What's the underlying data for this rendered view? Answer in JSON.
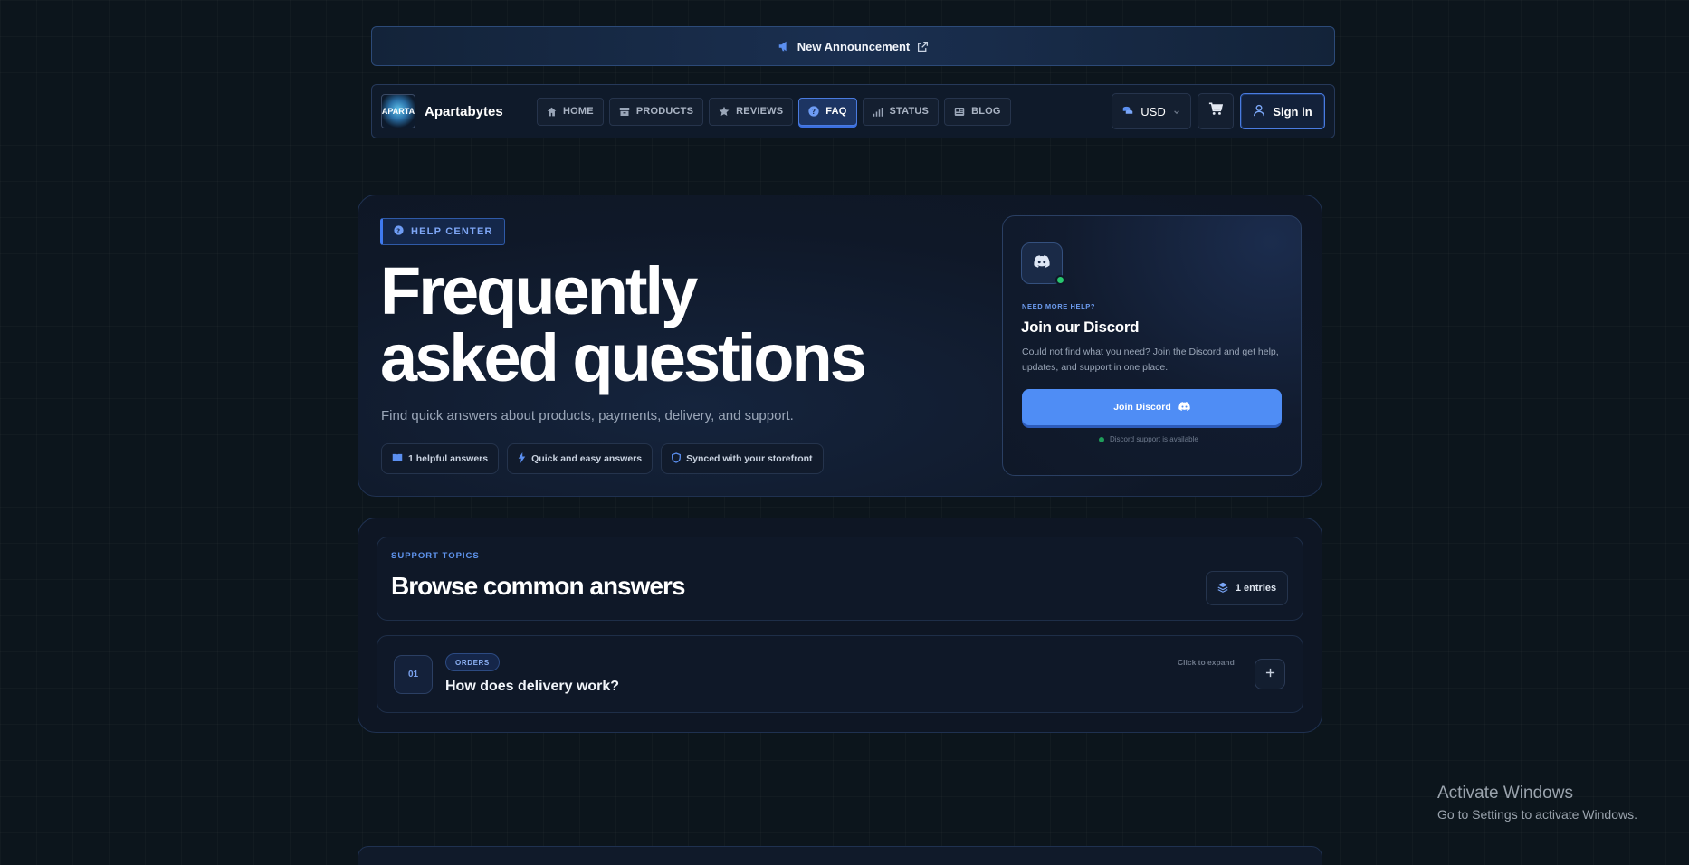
{
  "announcement": {
    "text": "New Announcement"
  },
  "nav": {
    "logo_text": "APARTA",
    "brand": "Apartabytes",
    "links": [
      {
        "label": "HOME",
        "icon": "home-icon"
      },
      {
        "label": "PRODUCTS",
        "icon": "box-icon"
      },
      {
        "label": "REVIEWS",
        "icon": "star-icon"
      },
      {
        "label": "FAQ",
        "icon": "question-circle-icon",
        "active": true
      },
      {
        "label": "STATUS",
        "icon": "signal-bars-icon"
      },
      {
        "label": "BLOG",
        "icon": "newspaper-icon"
      }
    ],
    "currency": "USD",
    "signin": "Sign in"
  },
  "hero": {
    "badge": "HELP CENTER",
    "title_line1": "Frequently",
    "title_line2": "asked questions",
    "subtitle": "Find quick answers about products, payments, delivery, and support.",
    "chips": [
      {
        "label": "1 helpful answers",
        "icon": "book-icon"
      },
      {
        "label": "Quick and easy answers",
        "icon": "bolt-icon"
      },
      {
        "label": "Synced with your storefront",
        "icon": "shield-icon"
      }
    ]
  },
  "discord": {
    "eyebrow": "NEED MORE HELP?",
    "title": "Join our Discord",
    "description": "Could not find what you need? Join the Discord and get help, updates, and support in one place.",
    "button": "Join Discord",
    "availability": "Discord support is available"
  },
  "topics": {
    "eyebrow": "SUPPORT TOPICS",
    "title": "Browse common answers",
    "entries": "1 entries",
    "items": [
      {
        "number": "01",
        "tag": "ORDERS",
        "question": "How does delivery work?",
        "hint": "Click to expand"
      }
    ]
  },
  "watermark": {
    "line1": "Activate Windows",
    "line2": "Go to Settings to activate Windows."
  },
  "colors": {
    "accent": "#4f8df5",
    "background": "#0c151c",
    "online": "#28c76f"
  }
}
